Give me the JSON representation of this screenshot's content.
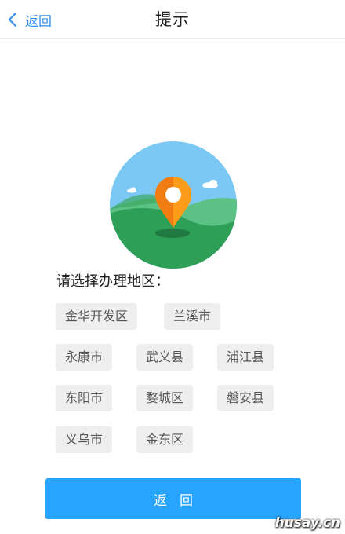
{
  "header": {
    "back_label": "返回",
    "title": "提示"
  },
  "illustration": {
    "icon": "map-location-pin-illustration",
    "colors": {
      "sky": "#7cc8f5",
      "hill_dark": "#2e9f57",
      "hill_light": "#5cc184",
      "pin_orange": "#ff9c1a",
      "cloud": "#ffffff"
    }
  },
  "prompt": "请选择办理地区：",
  "regions": [
    "金华开发区",
    "兰溪市",
    "永康市",
    "武义县",
    "浦江县",
    "东阳市",
    "婺城区",
    "磐安县",
    "义乌市",
    "金东区"
  ],
  "footer": {
    "button_label": "返回"
  },
  "watermark": "husay.cn",
  "colors": {
    "accent": "#2f8ff0",
    "button": "#27a4ff",
    "chip_bg": "#eeeeee"
  }
}
